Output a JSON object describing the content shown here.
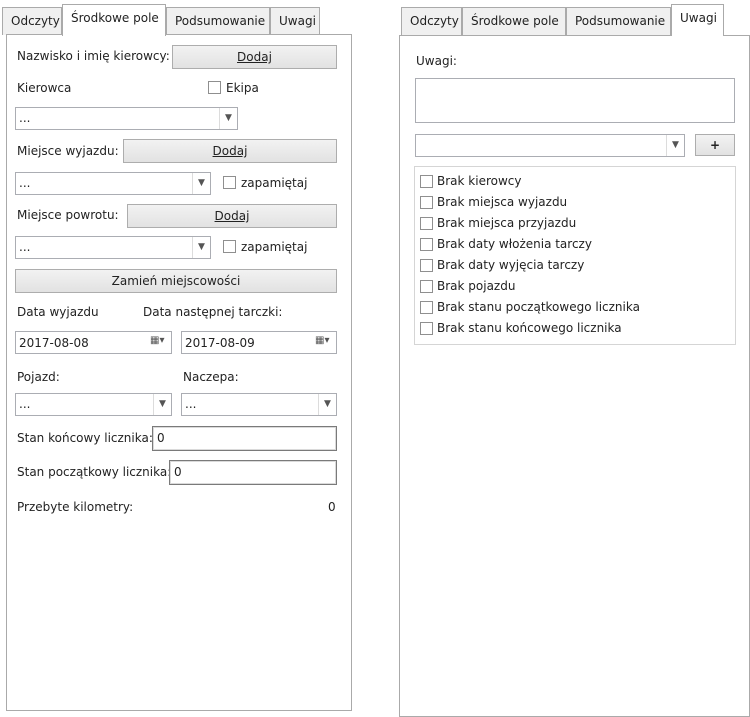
{
  "left": {
    "tabs": [
      "Odczyty",
      "Środkowe pole",
      "Podsumowanie",
      "Uwagi"
    ],
    "active_tab": "Środkowe pole",
    "driver_name_label": "Nazwisko i imię kierowcy:",
    "add_label": "Dodaj",
    "driver_label": "Kierowca",
    "crew_label": "Ekipa",
    "driver_value": "...",
    "departure_place_label": "Miejsce wyjazdu:",
    "departure_place_value": "...",
    "remember_label": "zapamiętaj",
    "return_place_label": "Miejsce powrotu:",
    "return_place_value": "...",
    "swap_button": "Zamień miejscowości",
    "departure_date_label": "Data wyjazdu",
    "next_disc_date_label": "Data następnej tarczki:",
    "departure_date_value": "2017-08-08",
    "next_disc_date_value": "2017-08-09",
    "vehicle_label": "Pojazd:",
    "trailer_label": "Naczepa:",
    "vehicle_value": "...",
    "trailer_value": "...",
    "end_counter_label": "Stan końcowy licznika:",
    "end_counter_value": "0",
    "start_counter_label": "Stan początkowy licznika:",
    "start_counter_value": "0",
    "km_label": "Przebyte kilometry:",
    "km_value": "0"
  },
  "right": {
    "tabs": [
      "Odczyty",
      "Środkowe pole",
      "Podsumowanie",
      "Uwagi"
    ],
    "active_tab": "Uwagi",
    "notes_label": "Uwagi:",
    "notes_value": "",
    "combo_value": "",
    "add_button": "+",
    "checklist": [
      "Brak kierowcy",
      "Brak miejsca wyjazdu",
      "Brak miejsca przyjazdu",
      "Brak daty włożenia tarczy",
      "Brak daty wyjęcia tarczy",
      "Brak pojazdu",
      "Brak stanu początkowego licznika",
      "Brak stanu końcowego licznika"
    ]
  }
}
